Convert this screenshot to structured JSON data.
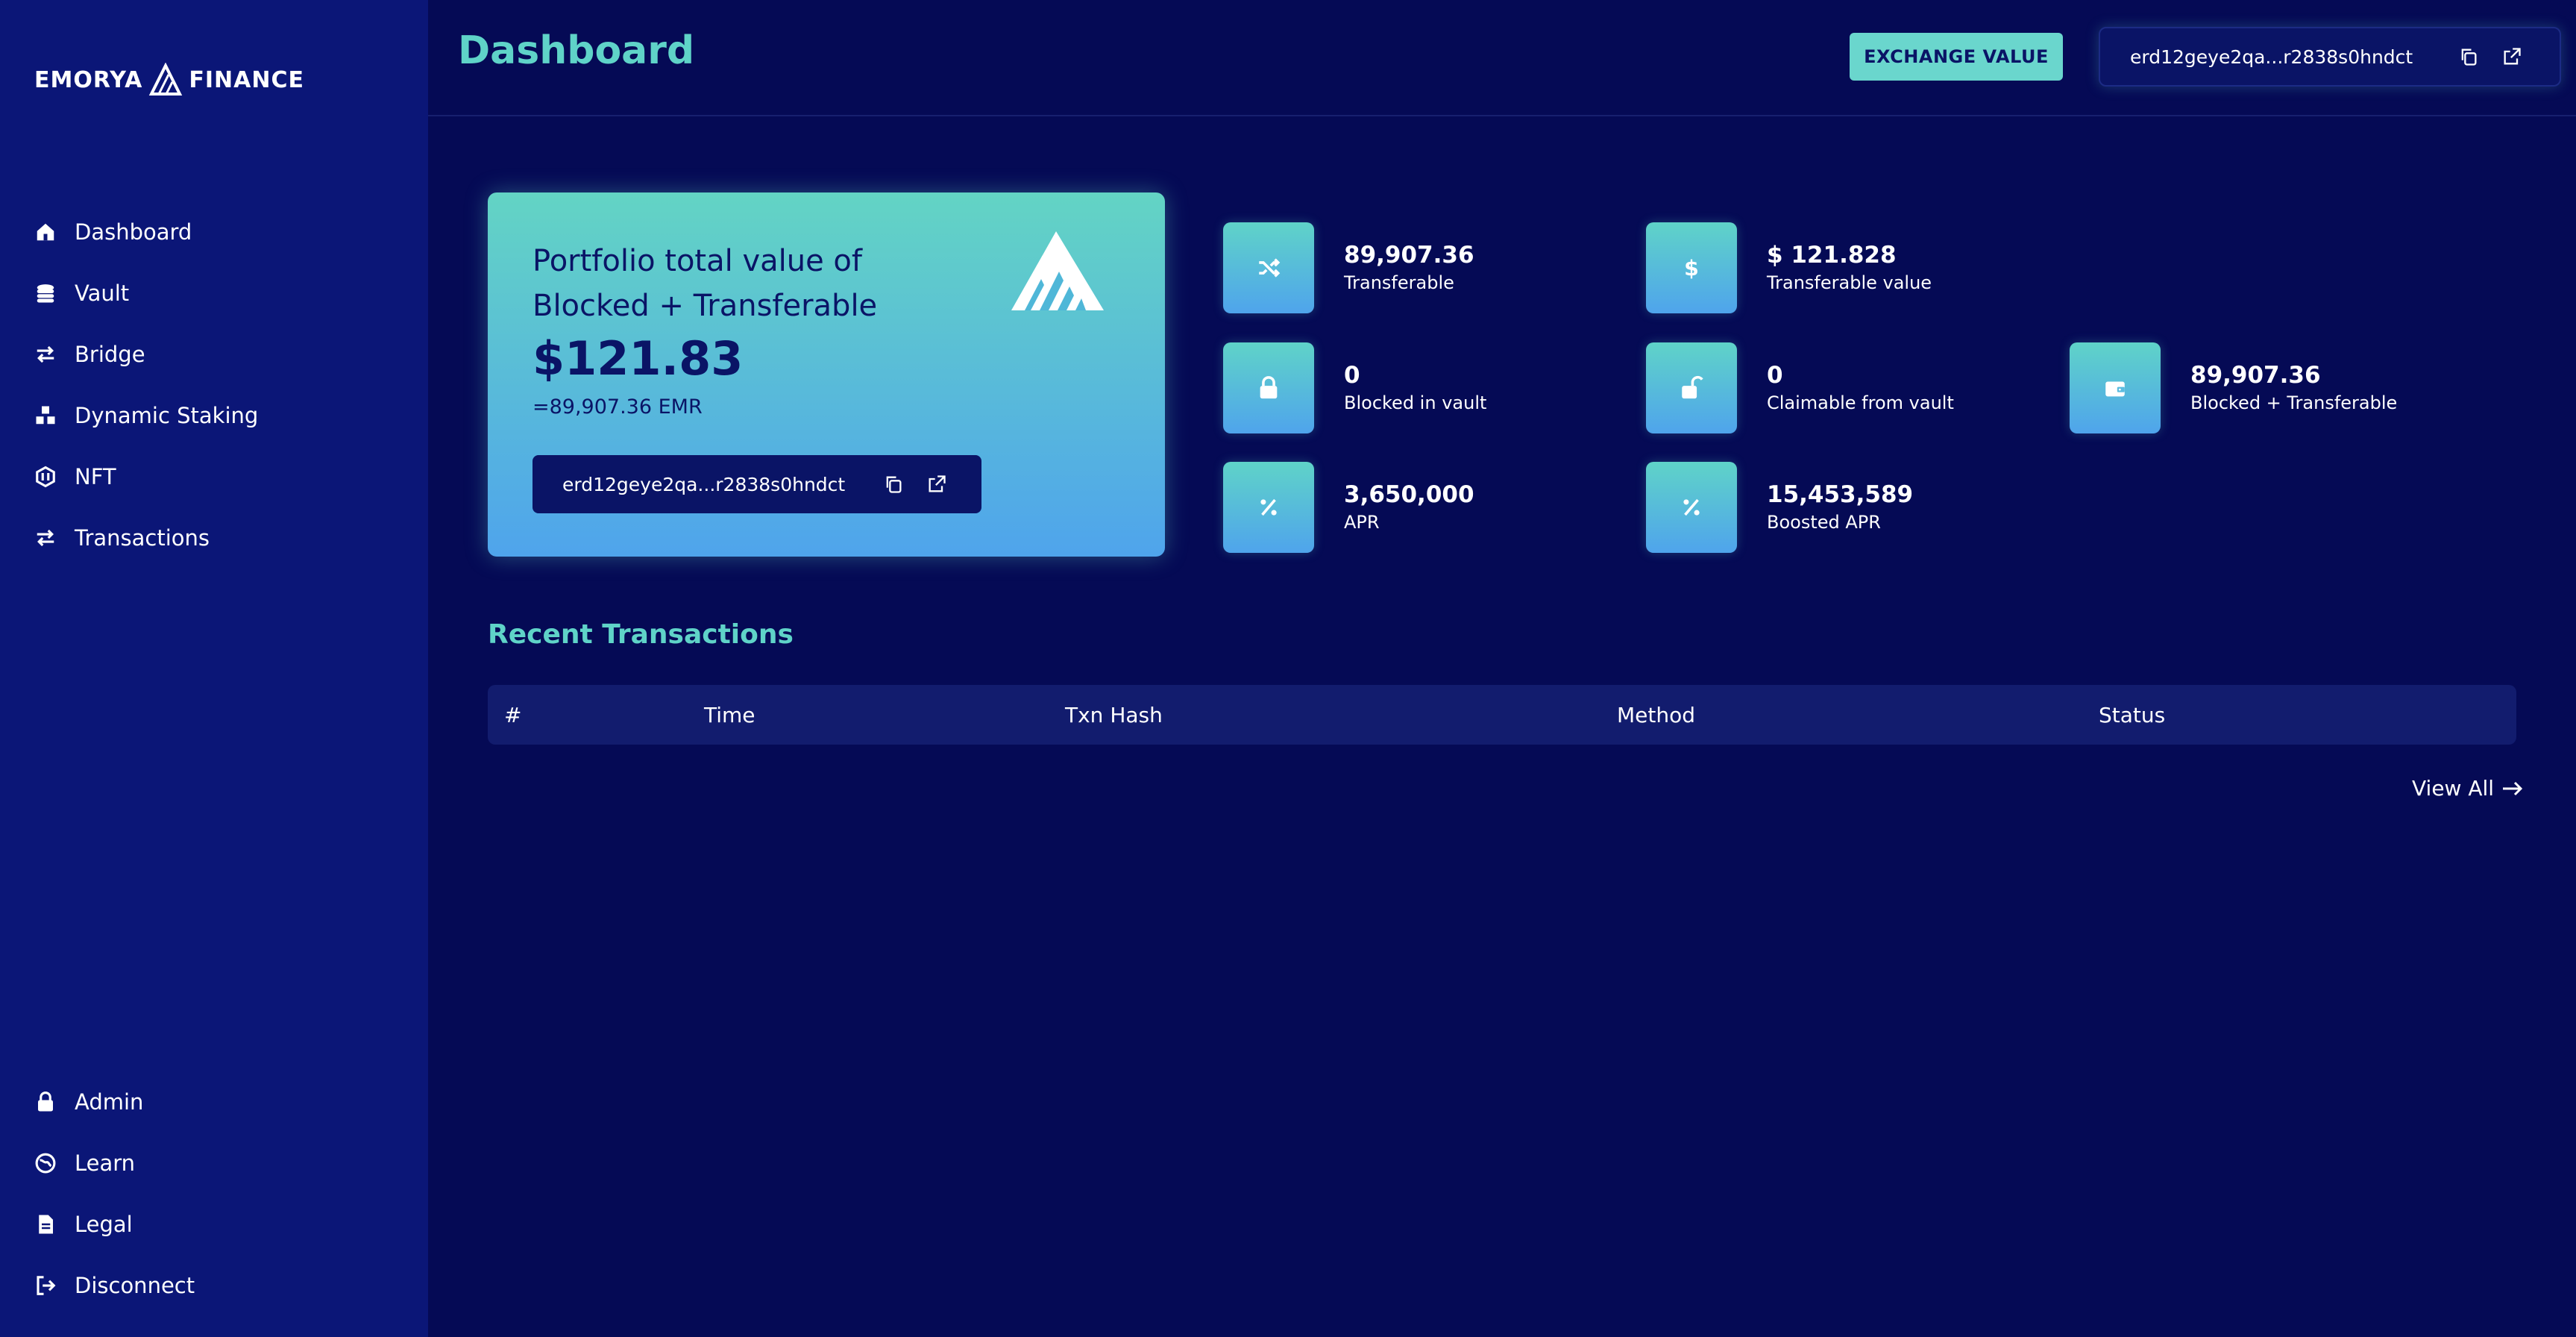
{
  "brand": {
    "logo_left": "EMORYA",
    "logo_right": "FINANCE"
  },
  "sidebar": {
    "items": [
      {
        "label": "Dashboard",
        "icon": "home-icon"
      },
      {
        "label": "Vault",
        "icon": "coins-icon"
      },
      {
        "label": "Bridge",
        "icon": "swap-arrows-icon"
      },
      {
        "label": "Dynamic Staking",
        "icon": "cubes-icon"
      },
      {
        "label": "NFT",
        "icon": "nft-icon"
      },
      {
        "label": "Transactions",
        "icon": "swap-arrows-icon"
      }
    ],
    "bottom_items": [
      {
        "label": "Admin",
        "icon": "lock-icon"
      },
      {
        "label": "Learn",
        "icon": "globe-icon"
      },
      {
        "label": "Legal",
        "icon": "document-icon"
      },
      {
        "label": "Disconnect",
        "icon": "sign-out-icon"
      }
    ]
  },
  "header": {
    "title": "Dashboard",
    "exchange_button": "EXCHANGE VALUE",
    "wallet_address": "erd12geye2qa...r2838s0hndct"
  },
  "portfolio": {
    "label": "Portfolio total value of Blocked + Transferable",
    "value": "$121.83",
    "sub": "=89,907.36 EMR",
    "address": "erd12geye2qa...r2838s0hndct"
  },
  "stats": [
    {
      "value": "89,907.36",
      "label": "Transferable",
      "icon": "shuffle-icon"
    },
    {
      "value": "$ 121.828",
      "label": "Transferable value",
      "icon": "dollar-icon"
    },
    {
      "value": "0",
      "label": "Blocked in vault",
      "icon": "lock-icon"
    },
    {
      "value": "0",
      "label": "Claimable from vault",
      "icon": "unlock-icon"
    },
    {
      "value": "89,907.36",
      "label": "Blocked + Transferable",
      "icon": "wallet-icon"
    },
    {
      "value": "3,650,000",
      "label": "APR",
      "icon": "percent-icon"
    },
    {
      "value": "15,453,589",
      "label": "Boosted APR",
      "icon": "percent-icon"
    }
  ],
  "transactions": {
    "title": "Recent Transactions",
    "columns": [
      "#",
      "Time",
      "Txn Hash",
      "Method",
      "Status"
    ],
    "view_all": "View All"
  },
  "colors": {
    "background": "#050a55",
    "sidebar": "#0b1677",
    "accent": "#5fd3c8",
    "accent_blue": "#4fa4ec"
  }
}
